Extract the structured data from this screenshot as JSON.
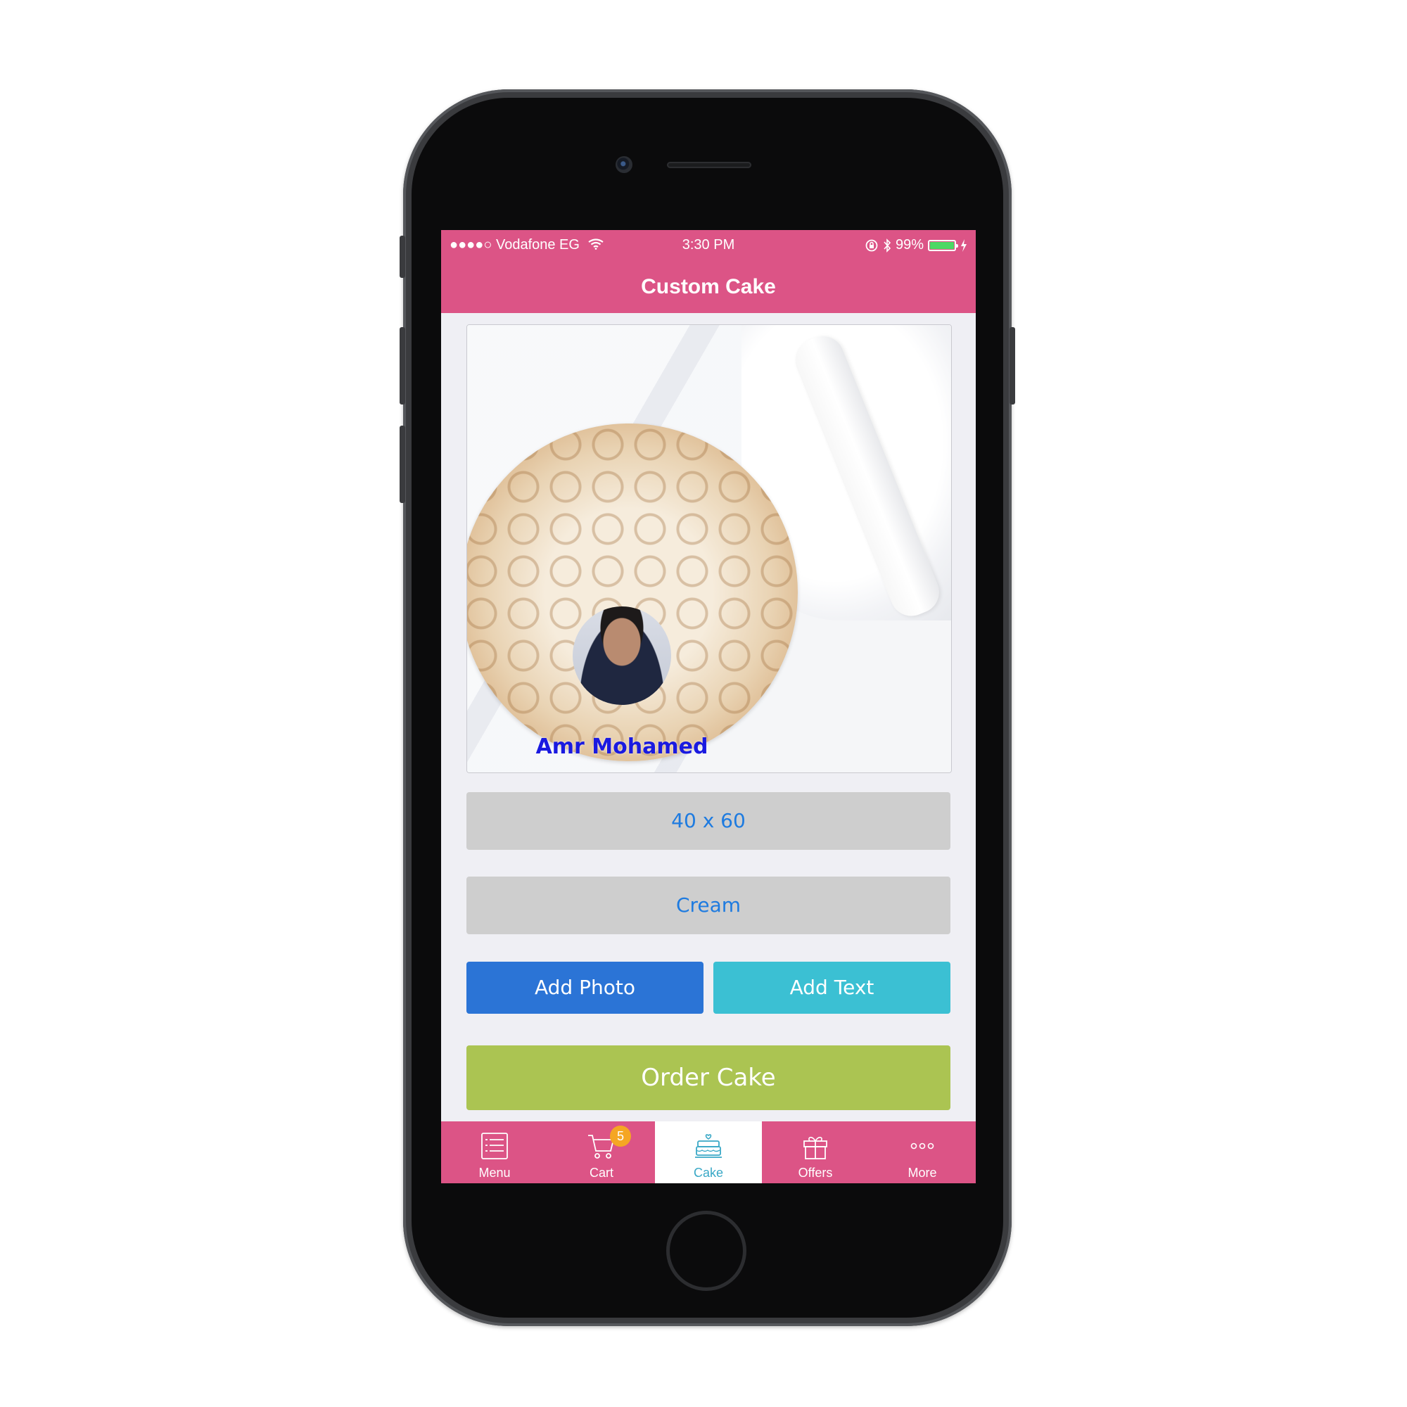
{
  "status_bar": {
    "signal": "●●●●○",
    "carrier": "Vodafone EG",
    "time": "3:30 PM",
    "battery_percent": "99%",
    "battery_level": 0.99
  },
  "nav": {
    "title": "Custom Cake"
  },
  "preview": {
    "cake_text": "Amr Mohamed"
  },
  "options": {
    "size": "40 x 60",
    "flavor": "Cream"
  },
  "actions": {
    "add_photo": "Add Photo",
    "add_text": "Add Text",
    "order": "Order Cake"
  },
  "colors": {
    "brand_pink": "#dc5486",
    "add_photo_blue": "#2b74d6",
    "add_text_teal": "#3bc0d3",
    "order_green": "#abc452",
    "active_tab": "#39a8c6",
    "badge": "#f5a623"
  },
  "tabs": [
    {
      "label": "Menu",
      "icon": "list-icon"
    },
    {
      "label": "Cart",
      "icon": "cart-icon",
      "badge": "5"
    },
    {
      "label": "Cake",
      "icon": "cake-icon",
      "active": true
    },
    {
      "label": "Offers",
      "icon": "gift-icon"
    },
    {
      "label": "More",
      "icon": "more-dots-icon"
    }
  ]
}
